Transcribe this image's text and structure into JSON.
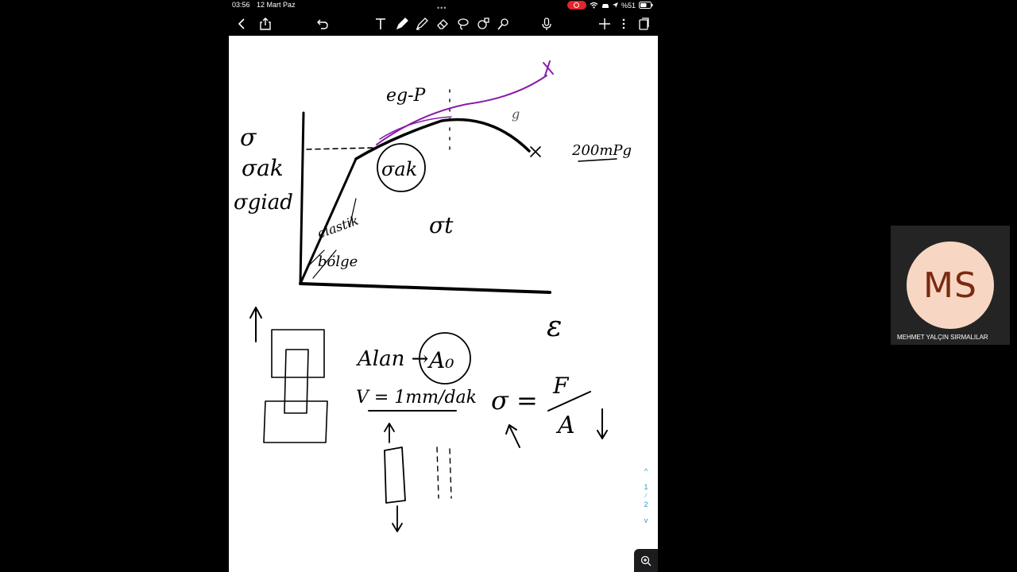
{
  "status": {
    "time": "03:56",
    "date": "12 Mart Paz",
    "battery": "%51"
  },
  "sketch_text": {
    "sigma": "σ",
    "sigma_ak": "σak",
    "sigma_giad": "σgiad",
    "eg_p": "eg-P",
    "sigma_ak_circle": "σak",
    "elastik": "elastik",
    "bolge": "bölge",
    "sigma_t": "σt",
    "zoom_pq": "200mPg",
    "g": "g",
    "epsilon": "ε",
    "alan": "Alan →",
    "a0": "A₀",
    "v_speed": "V = 1mm/dak",
    "formula_sigma": "σ =",
    "formula_f": "F",
    "formula_a": "A"
  },
  "pager": {
    "prev": "^",
    "page_1": "1",
    "page_2": "2",
    "next": "v"
  },
  "participant": {
    "initials": "MS",
    "name": "MEHMET YALÇIN SIRMALILAR",
    "avatar_color": "#f7d7c3"
  },
  "colors": {
    "ink": "#000000",
    "purple": "#8a1ca8",
    "accent": "#2b93c9",
    "rec": "#e0262b"
  },
  "icons": [
    "back-icon",
    "share-icon",
    "undo-icon",
    "text-tool-icon",
    "pen-icon",
    "highlighter-icon",
    "eraser-icon",
    "lasso-icon",
    "shapes-icon",
    "laser-icon",
    "mic-icon",
    "add-icon",
    "more-icon",
    "pages-icon",
    "zoom-icon"
  ]
}
